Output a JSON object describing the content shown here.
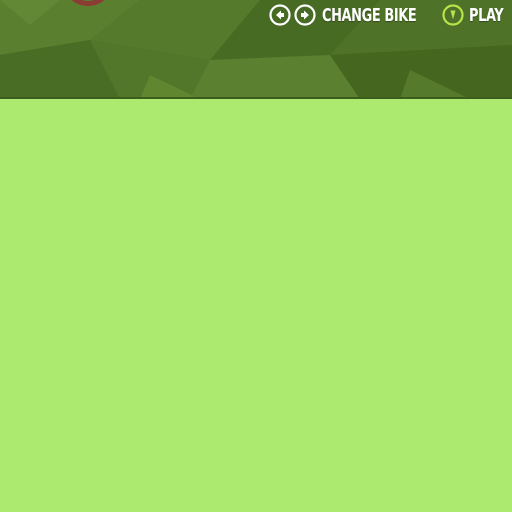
{
  "header": {
    "change_bike_label": "CHANGE BIKE",
    "play_label": "PLAY"
  },
  "icons": {
    "prev_bike": "arrow-left-circle-icon",
    "next_bike": "arrow-right-circle-icon",
    "play": "play-circle-icon",
    "bike_wheel": "bike-wheel-icon"
  },
  "colors": {
    "header_bg": "#4c6e27",
    "lower_bg": "#abe96f",
    "label_text": "#ffffff",
    "play_icon": "#b8e34a",
    "wheel": "#8a3b33"
  }
}
